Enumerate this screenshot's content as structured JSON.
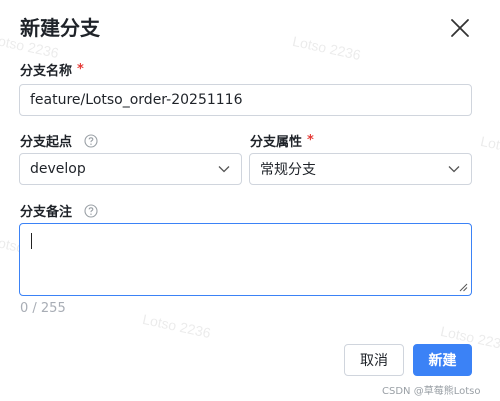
{
  "dialog": {
    "title": "新建分支",
    "close_icon": "close-icon"
  },
  "branch_name": {
    "label": "分支名称",
    "required_mark": "*",
    "value": "feature/Lotso_order-20251116"
  },
  "branch_origin": {
    "label": "分支起点",
    "help_icon": "question-circle-icon",
    "selected": "develop"
  },
  "branch_attribute": {
    "label": "分支属性",
    "required_mark": "*",
    "selected": "常规分支"
  },
  "branch_note": {
    "label": "分支备注",
    "help_icon": "question-circle-icon",
    "value": "",
    "counter": "0 / 255"
  },
  "buttons": {
    "cancel": "取消",
    "create": "新建"
  },
  "watermark_text": "Lotso 2236",
  "credit": "CSDN @草莓熊Lotso",
  "colors": {
    "primary": "#3b82f6",
    "required": "#e53935",
    "border": "#d0d5dd",
    "text": "#1f2329",
    "muted": "#a8adb5"
  }
}
